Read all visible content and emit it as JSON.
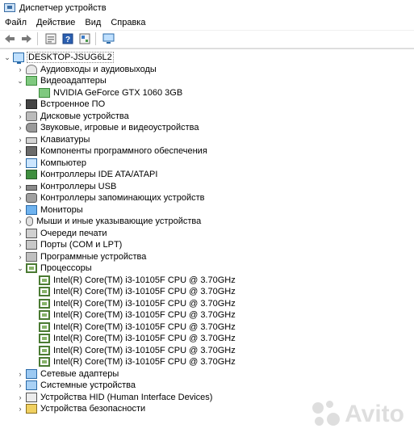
{
  "window": {
    "title": "Диспетчер устройств"
  },
  "menu": [
    "Файл",
    "Действие",
    "Вид",
    "Справка"
  ],
  "toolbar": {
    "buttons": [
      "back-icon",
      "forward-icon",
      "properties-icon",
      "help-icon",
      "update-driver-icon",
      "scan-hardware-icon"
    ]
  },
  "tree": {
    "root": "DESKTOP-JSUG6L2",
    "categories": [
      {
        "label": "Аудиовходы и аудиовыходы",
        "icon": "audio-io-icon",
        "expanded": false
      },
      {
        "label": "Видеоадаптеры",
        "icon": "display-adapter-icon",
        "expanded": true,
        "children": [
          "NVIDIA GeForce GTX 1060 3GB"
        ]
      },
      {
        "label": "Встроенное ПО",
        "icon": "firmware-icon",
        "expanded": false
      },
      {
        "label": "Дисковые устройства",
        "icon": "disk-icon",
        "expanded": false
      },
      {
        "label": "Звуковые, игровые и видеоустройства",
        "icon": "sound-icon",
        "expanded": false
      },
      {
        "label": "Клавиатуры",
        "icon": "keyboard-icon",
        "expanded": false
      },
      {
        "label": "Компоненты программного обеспечения",
        "icon": "software-component-icon",
        "expanded": false
      },
      {
        "label": "Компьютер",
        "icon": "computer-icon",
        "expanded": false
      },
      {
        "label": "Контроллеры IDE ATA/ATAPI",
        "icon": "ide-controller-icon",
        "expanded": false
      },
      {
        "label": "Контроллеры USB",
        "icon": "usb-icon",
        "expanded": false
      },
      {
        "label": "Контроллеры запоминающих устройств",
        "icon": "storage-controller-icon",
        "expanded": false
      },
      {
        "label": "Мониторы",
        "icon": "monitor-icon",
        "expanded": false
      },
      {
        "label": "Мыши и иные указывающие устройства",
        "icon": "mouse-icon",
        "expanded": false
      },
      {
        "label": "Очереди печати",
        "icon": "print-queue-icon",
        "expanded": false
      },
      {
        "label": "Порты (COM и LPT)",
        "icon": "port-icon",
        "expanded": false
      },
      {
        "label": "Программные устройства",
        "icon": "software-device-icon",
        "expanded": false
      },
      {
        "label": "Процессоры",
        "icon": "processor-icon",
        "expanded": true,
        "children": [
          "Intel(R) Core(TM) i3-10105F CPU @ 3.70GHz",
          "Intel(R) Core(TM) i3-10105F CPU @ 3.70GHz",
          "Intel(R) Core(TM) i3-10105F CPU @ 3.70GHz",
          "Intel(R) Core(TM) i3-10105F CPU @ 3.70GHz",
          "Intel(R) Core(TM) i3-10105F CPU @ 3.70GHz",
          "Intel(R) Core(TM) i3-10105F CPU @ 3.70GHz",
          "Intel(R) Core(TM) i3-10105F CPU @ 3.70GHz",
          "Intel(R) Core(TM) i3-10105F CPU @ 3.70GHz"
        ]
      },
      {
        "label": "Сетевые адаптеры",
        "icon": "network-adapter-icon",
        "expanded": false
      },
      {
        "label": "Системные устройства",
        "icon": "system-device-icon",
        "expanded": false
      },
      {
        "label": "Устройства HID (Human Interface Devices)",
        "icon": "hid-icon",
        "expanded": false
      },
      {
        "label": "Устройства безопасности",
        "icon": "security-device-icon",
        "expanded": false
      }
    ]
  },
  "watermark": {
    "text": "Avito"
  }
}
